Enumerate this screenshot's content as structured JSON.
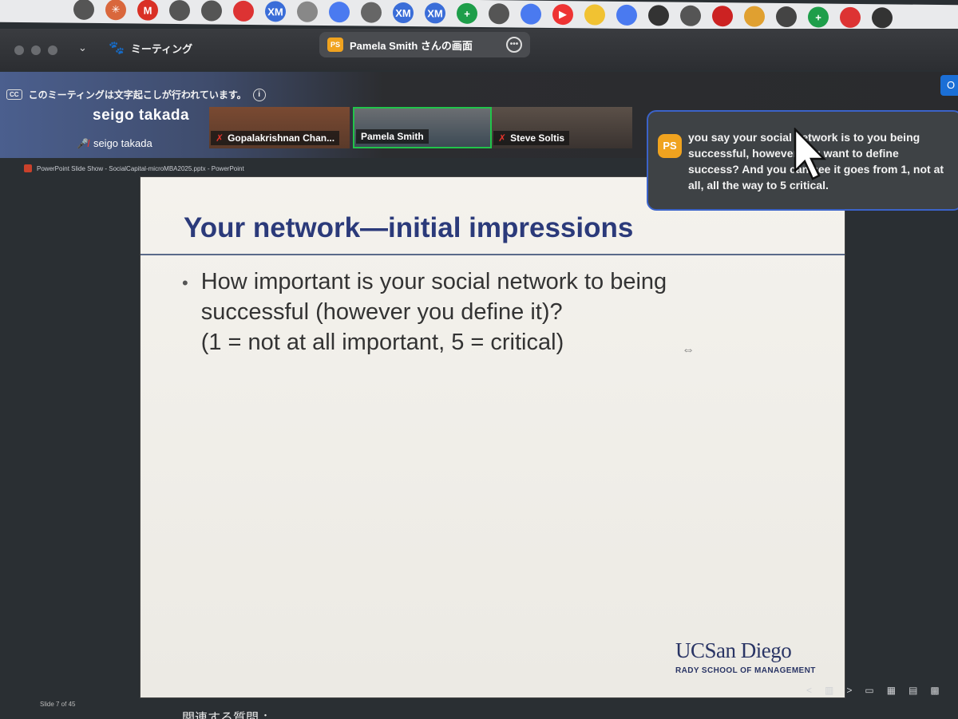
{
  "bookmarks": [
    {
      "icon": "globe-icon",
      "label": "",
      "color": "#555555"
    },
    {
      "icon": "claude-icon",
      "label": "✳",
      "color": "#d9673c"
    },
    {
      "icon": "gmail-icon",
      "label": "M",
      "color": "#d93025"
    },
    {
      "icon": "globe-icon",
      "label": "",
      "color": "#555555"
    },
    {
      "icon": "globe-icon",
      "label": "",
      "color": "#555555"
    },
    {
      "icon": "red-circle-icon",
      "label": "",
      "color": "#d33"
    },
    {
      "icon": "xm-icon",
      "label": "XM",
      "color": "#3a6dd8"
    },
    {
      "icon": "gear-icon",
      "label": "",
      "color": "#888"
    },
    {
      "icon": "docs-icon",
      "label": "",
      "color": "#4a7af0"
    },
    {
      "icon": "openai-icon",
      "label": "",
      "color": "#666"
    },
    {
      "icon": "xm-icon",
      "label": "XM",
      "color": "#3a6dd8"
    },
    {
      "icon": "xm-icon",
      "label": "XM",
      "color": "#3a6dd8"
    },
    {
      "icon": "sheets-icon",
      "label": "+",
      "color": "#1e9e4a"
    },
    {
      "icon": "globe-icon",
      "label": "",
      "color": "#555555"
    },
    {
      "icon": "flower-icon",
      "label": "",
      "color": "#4a7af0"
    },
    {
      "icon": "play-icon",
      "label": "▶",
      "color": "#e33"
    },
    {
      "icon": "star-icon",
      "label": "",
      "color": "#f1c232"
    },
    {
      "icon": "flower-icon",
      "label": "",
      "color": "#4a7af0"
    },
    {
      "icon": "github-icon",
      "label": "",
      "color": "#333"
    },
    {
      "icon": "globe-icon",
      "label": "",
      "color": "#555555"
    },
    {
      "icon": "gem-icon",
      "label": "",
      "color": "#c22"
    },
    {
      "icon": "gif-icon",
      "label": "",
      "color": "#e0a030"
    },
    {
      "icon": "dice-icon",
      "label": "",
      "color": "#444"
    },
    {
      "icon": "sheets-icon",
      "label": "+",
      "color": "#1e9e4a"
    },
    {
      "icon": "flower-icon",
      "label": "",
      "color": "#d33"
    },
    {
      "icon": "github-icon",
      "label": "",
      "color": "#333"
    }
  ],
  "zoom": {
    "meeting_label": "ミーティング",
    "sharer_badge": "PS",
    "sharer_title": "Pamela Smith さんの画面",
    "more_label": "•••",
    "top_right_button": "O"
  },
  "transcription_notice": {
    "cc_label": "CC",
    "text": "このミーティングは文字起こしが行われています。",
    "info_label": "i"
  },
  "self_video": {
    "big_name": "seigo takada",
    "name": "seigo takada"
  },
  "participants": [
    {
      "name": "Gopalakrishnan Chan...",
      "muted": true
    },
    {
      "name": "Pamela Smith",
      "muted": false
    },
    {
      "name": "Steve Soltis",
      "muted": true
    }
  ],
  "ppt_window_title": "PowerPoint Slide Show - SocialCapital-microMBA2025.pptx - PowerPoint",
  "slide": {
    "title": "Your network—initial impressions",
    "bullet_line1": "How important is your social network to being",
    "bullet_line2": "successful (however you define it)?",
    "bullet_line3": "(1 = not at all important, 5 = critical)",
    "bullet_symbol": "•",
    "resize_glyph": "⇔",
    "logo_main": "UCSan Diego",
    "logo_sub": "RADY SCHOOL OF MANAGEMENT"
  },
  "caption": {
    "badge": "PS",
    "text": "you say your social network is to you being successful, however you want to define success? And you can see it goes from 1, not at all, all the way to 5 critical."
  },
  "status": {
    "slide_counter": "Slide 7 of 45",
    "controls": [
      "<",
      "▥",
      ">",
      "▭",
      "▦",
      "▤",
      "▩"
    ]
  },
  "bottom_text": "関連する質問 ："
}
